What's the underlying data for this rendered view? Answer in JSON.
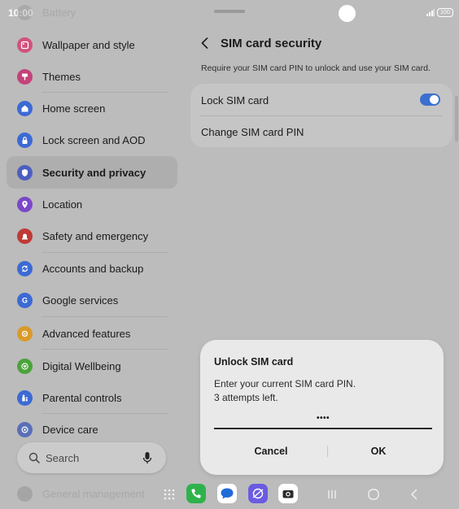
{
  "status_bar": {
    "time": "10:00",
    "battery": "100"
  },
  "sidebar": {
    "items": [
      {
        "label": "Battery",
        "color": "#8a8a8a"
      },
      {
        "label": "Wallpaper and style",
        "color": "#d2517d"
      },
      {
        "label": "Themes",
        "color": "#c4427a"
      },
      {
        "label": "Home screen",
        "color": "#3c6ad4"
      },
      {
        "label": "Lock screen and AOD",
        "color": "#3c6ad4"
      },
      {
        "label": "Security and privacy",
        "color": "#4d5fbf"
      },
      {
        "label": "Location",
        "color": "#7b47c8"
      },
      {
        "label": "Safety and emergency",
        "color": "#c03a35"
      },
      {
        "label": "Accounts and backup",
        "color": "#3c6ad4"
      },
      {
        "label": "Google services",
        "color": "#3c6ad4"
      },
      {
        "label": "Advanced features",
        "color": "#d99a2b"
      },
      {
        "label": "Digital Wellbeing",
        "color": "#4aa33b"
      },
      {
        "label": "Parental controls",
        "color": "#3c6ad4"
      },
      {
        "label": "Device care",
        "color": "#5a6fb8"
      },
      {
        "label": "General management",
        "color": "#7a7a7a"
      }
    ],
    "search_placeholder": "Search"
  },
  "page": {
    "title": "SIM card security",
    "description": "Require your SIM card PIN to unlock and use your SIM card.",
    "options": [
      {
        "label": "Lock SIM card",
        "toggle_on": true
      },
      {
        "label": "Change SIM card PIN"
      }
    ]
  },
  "dialog": {
    "title": "Unlock SIM card",
    "message_line1": "Enter your current SIM card PIN.",
    "message_line2": "3 attempts left.",
    "pin_value": "••••",
    "cancel_label": "Cancel",
    "ok_label": "OK"
  },
  "taskbar": {
    "apps": [
      {
        "icon": "phone-icon",
        "color": "#2fb24b"
      },
      {
        "icon": "messages-icon",
        "color": "#ffffff"
      },
      {
        "icon": "internet-icon",
        "color": "#6b5be0"
      },
      {
        "icon": "camera-icon",
        "color": "#ffffff"
      }
    ]
  },
  "colors": {
    "accent": "#3d6fd0",
    "background": "#bcbcbc"
  }
}
